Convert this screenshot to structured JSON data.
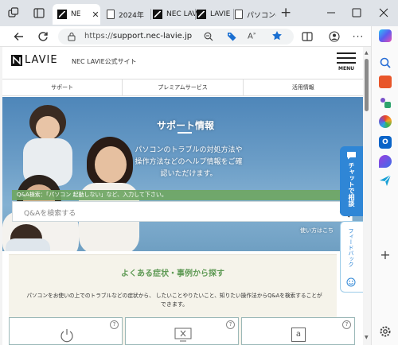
{
  "browser": {
    "tabs": [
      {
        "label": "NE",
        "type": "lavie",
        "active": true
      },
      {
        "label": "2024年",
        "type": "doc",
        "active": false
      },
      {
        "label": "NEC LAV",
        "type": "lavie",
        "active": false
      },
      {
        "label": "LAVIE N",
        "type": "lavie",
        "active": false
      },
      {
        "label": "パソコンの",
        "type": "doc",
        "active": false
      }
    ],
    "close_glyph": "✕",
    "new_tab_glyph": "+",
    "url_scheme": "https://",
    "url_host": "support.nec-lavie.jp"
  },
  "site": {
    "logo_text": "LAVIE",
    "site_title": "NEC LAVIE公式サイト",
    "menu_label": "MENU",
    "nav": [
      "サポート",
      "プレミアムサービス",
      "活用情報"
    ]
  },
  "hero": {
    "title": "サポート情報",
    "description_lines": [
      "パソコンのトラブルの対処方法や",
      "操作方法などのヘルプ情報をご確",
      "認いただけます。"
    ],
    "search_hint": "Q&A検索：「パソコン 起動しない」など、入力して下さい。",
    "search_placeholder": "Q&Aを検索する",
    "howto_link": "使い方はこち"
  },
  "floating": {
    "chat_label": "チャットで相談",
    "feedback_label": "フィードバック"
  },
  "symptoms": {
    "heading": "よくある症状・事例から探す",
    "desc_line1": "パソコンをお使いの上でのトラブルなどの症状から、 したいことやりたいこと、知りたい操作法からQ&Aを検索することが",
    "desc_line2": "できます。",
    "category_glyphs": [
      "",
      "",
      "a"
    ],
    "help_glyph": "?"
  },
  "colors": {
    "accent_green": "#6fa663",
    "tab_bar": "#dfe3e8",
    "chat_blue": "#2f86d6",
    "feedback_border": "#9ccbe8"
  }
}
